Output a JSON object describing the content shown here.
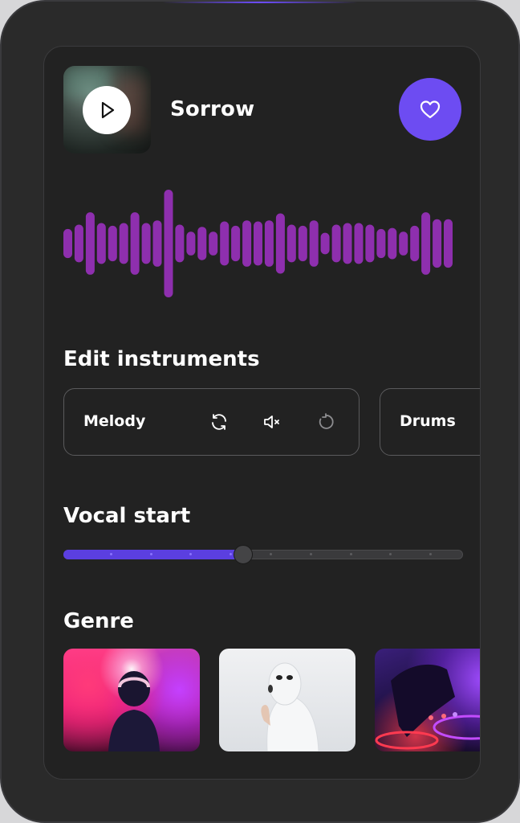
{
  "track": {
    "title": "Sorrow"
  },
  "sections": {
    "edit_instruments": "Edit instruments",
    "vocal_start": "Vocal start",
    "genre": "Genre"
  },
  "instruments": [
    {
      "label": "Melody"
    },
    {
      "label": "Drums"
    }
  ],
  "vocal_start_value": 0.45,
  "waveform_levels": [
    0.27,
    0.35,
    0.58,
    0.38,
    0.33,
    0.38,
    0.58,
    0.38,
    0.43,
    1.0,
    0.35,
    0.22,
    0.31,
    0.22,
    0.41,
    0.33,
    0.43,
    0.41,
    0.43,
    0.56,
    0.35,
    0.33,
    0.43,
    0.2,
    0.35,
    0.38,
    0.38,
    0.35,
    0.27,
    0.29,
    0.22,
    0.33,
    0.58,
    0.45,
    0.45
  ],
  "colors": {
    "accent": "#6d4cf2",
    "waveform": "#8e2fae",
    "background": "#222222"
  },
  "icons": [
    "play-icon",
    "heart-icon",
    "sync-icon",
    "mute-icon",
    "reset-icon"
  ]
}
